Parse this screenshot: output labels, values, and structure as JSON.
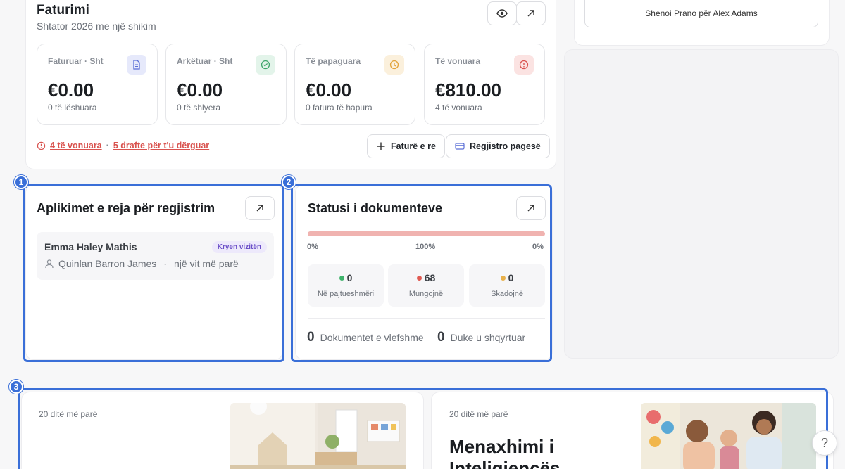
{
  "billing": {
    "title": "Faturimi",
    "subtitle": "Shtator 2026 me një shikim",
    "stats": [
      {
        "label": "Faturuar · Sht",
        "value": "€0.00",
        "caption": "0 të lëshuara",
        "icon": "document-icon",
        "color": "#5b6fd6"
      },
      {
        "label": "Arkëtuar · Sht",
        "value": "€0.00",
        "caption": "0 të shlyera",
        "icon": "check-circle-icon",
        "color": "#3fa66b"
      },
      {
        "label": "Të papaguara",
        "value": "€0.00",
        "caption": "0 fatura të hapura",
        "icon": "clock-icon",
        "color": "#e2a33b"
      },
      {
        "label": "Të vonuara",
        "value": "€810.00",
        "caption": "4 të vonuara",
        "icon": "alert-icon",
        "color": "#d9534f"
      }
    ],
    "alert": {
      "overdue": "4 të vonuara",
      "sep": "·",
      "drafts": "5 drafte për t'u dërguar"
    },
    "new_invoice": "Faturë e re",
    "record_payment": "Regjistro pagesë"
  },
  "schedule_button": "Shenoi Prano për Alex Adams",
  "applications": {
    "title": "Aplikimet e reja për regjistrim",
    "items": [
      {
        "child": "Emma Haley Mathis",
        "tag": "Kryen vizitën",
        "parent": "Quinlan Barron James",
        "sep": "·",
        "time": "një vit më parë"
      }
    ]
  },
  "documents": {
    "title": "Statusi i dokumenteve",
    "progress": {
      "left": "0%",
      "mid": "100%",
      "right": "0%"
    },
    "counts": [
      {
        "value": "0",
        "label": "Në pajtueshmëri",
        "color": "#3fb36b"
      },
      {
        "value": "68",
        "label": "Mungojnë",
        "color": "#e05a52"
      },
      {
        "value": "0",
        "label": "Skadojnë",
        "color": "#e8b04a"
      }
    ],
    "valid_count": "0",
    "valid_label": "Dokumentet e vlefshme",
    "review_count": "0",
    "review_label": "Duke u shqyrtuar"
  },
  "badges": [
    "1",
    "2",
    "3"
  ],
  "news": [
    {
      "date": "20 ditë më parë",
      "title": ""
    },
    {
      "date": "20 ditë më parë",
      "title": "Menaxhimi i Inteligjencës"
    }
  ],
  "help": "?"
}
